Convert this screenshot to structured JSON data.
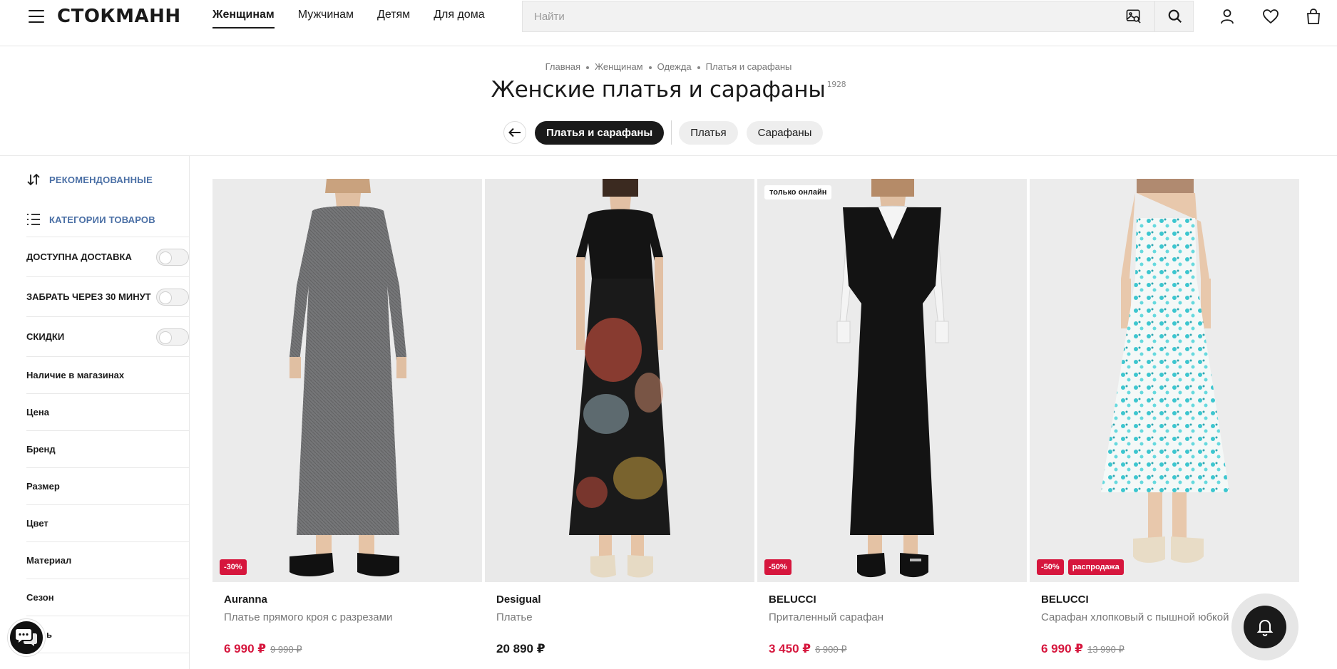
{
  "header": {
    "logo": "СТОКМАНН",
    "nav": [
      "Женщинам",
      "Мужчинам",
      "Детям",
      "Для дома"
    ],
    "active_nav": "Женщинам",
    "search_placeholder": "Найти"
  },
  "breadcrumb": [
    "Главная",
    "Женщинам",
    "Одежда",
    "Платья и сарафаны"
  ],
  "page_title": "Женские платья и сарафаны",
  "product_count": "1928",
  "chips": [
    {
      "label": "Платья и сарафаны",
      "active": true
    },
    {
      "label": "Платья",
      "active": false
    },
    {
      "label": "Сарафаны",
      "active": false
    }
  ],
  "sidebar": {
    "sort_label": "РЕКОМЕНДОВАННЫЕ",
    "categories_label": "КАТЕГОРИИ ТОВАРОВ",
    "toggles": [
      "ДОСТУПНА ДОСТАВКА",
      "ЗАБРАТЬ ЧЕРЕЗ 30 МИНУТ",
      "СКИДКИ"
    ],
    "filters": [
      "Наличие в магазинах",
      "Цена",
      "Бренд",
      "Размер",
      "Цвет",
      "Материал",
      "Сезон",
      "ь"
    ]
  },
  "products": [
    {
      "brand": "Auranna",
      "name": "Платье прямого кроя с разрезами",
      "price": "6 990 ₽",
      "old_price": "9 990 ₽",
      "badges": [
        "-30%"
      ],
      "top_badge": "",
      "sale": true
    },
    {
      "brand": "Desigual",
      "name": "Платье",
      "price": "20 890 ₽",
      "old_price": "",
      "badges": [],
      "top_badge": "",
      "sale": false
    },
    {
      "brand": "BELUCCI",
      "name": "Приталенный сарафан",
      "price": "3 450 ₽",
      "old_price": "6 900 ₽",
      "badges": [
        "-50%"
      ],
      "top_badge": "только онлайн",
      "sale": true
    },
    {
      "brand": "BELUCCI",
      "name": "Сарафан хлопковый с пышной юбкой",
      "price": "6 990 ₽",
      "old_price": "13 990 ₽",
      "badges": [
        "-50%",
        "распродажа"
      ],
      "top_badge": "",
      "sale": true
    }
  ],
  "colors": {
    "accent": "#d6163d",
    "link": "#4a6fa5",
    "dark": "#1a1a1a"
  }
}
